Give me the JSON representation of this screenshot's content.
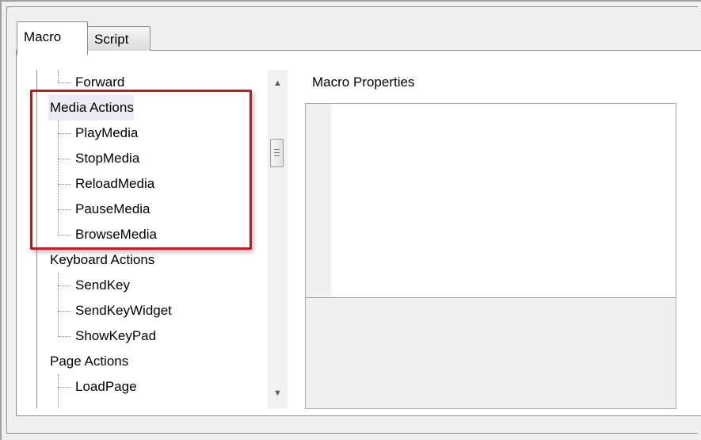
{
  "tabs": [
    {
      "label": "Macro",
      "active": true
    },
    {
      "label": "Script",
      "active": false
    }
  ],
  "tree": {
    "items": [
      {
        "type": "child",
        "label": "Forward"
      },
      {
        "type": "category",
        "label": "Media Actions"
      },
      {
        "type": "child",
        "label": "PlayMedia"
      },
      {
        "type": "child",
        "label": "StopMedia"
      },
      {
        "type": "child",
        "label": "ReloadMedia"
      },
      {
        "type": "child",
        "label": "PauseMedia"
      },
      {
        "type": "child",
        "label": "BrowseMedia"
      },
      {
        "type": "category",
        "label": "Keyboard Actions"
      },
      {
        "type": "child",
        "label": "SendKey"
      },
      {
        "type": "child",
        "label": "SendKeyWidget"
      },
      {
        "type": "child",
        "label": "ShowKeyPad"
      },
      {
        "type": "category",
        "label": "Page Actions"
      },
      {
        "type": "child",
        "label": "LoadPage"
      }
    ]
  },
  "scrollbar": {
    "up_icon": "triangle-up",
    "down_icon": "triangle-down",
    "up_glyph": "▲",
    "down_glyph": "▼"
  },
  "properties": {
    "title": "Macro Properties"
  },
  "colors": {
    "highlight_border": "#b51e25",
    "selected_category_bg": "#ececf4",
    "panel_gray": "#f0f0f0"
  }
}
